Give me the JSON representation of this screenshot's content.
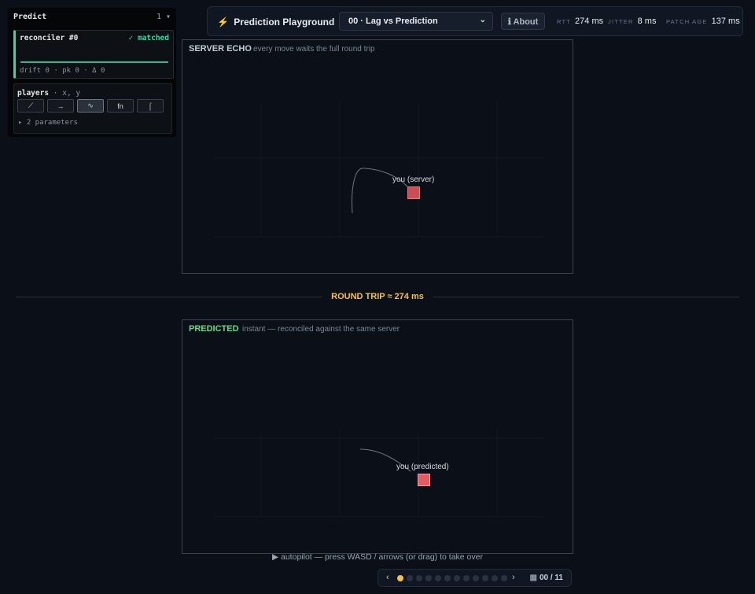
{
  "panel": {
    "title": "Predict",
    "count": "1 ▾",
    "reconciler": {
      "name": "reconciler #0",
      "status": "✓ matched",
      "drift": "drift 0 · pk 0 · Δ 0"
    },
    "players": {
      "label": "players",
      "fields": "· x, y",
      "tools": [
        {
          "name": "tool-linear",
          "glyph": "⟋"
        },
        {
          "name": "tool-step",
          "glyph": "→"
        },
        {
          "name": "tool-wave",
          "glyph": "∿"
        },
        {
          "name": "tool-function",
          "glyph": "fn"
        },
        {
          "name": "tool-curve",
          "glyph": "⌠"
        }
      ],
      "active_tool": "tool-wave",
      "params": "▸ 2 parameters"
    }
  },
  "topbar": {
    "bolt": "⚡",
    "title": "Prediction Playground",
    "scenario": "00 · Lag vs Prediction",
    "scenario_chevron": "⌄",
    "about": "ℹ About",
    "rtt_label": "RTT",
    "rtt_value": "274 ms",
    "jitter_label": "JITTER",
    "jitter_value": "8 ms",
    "patch_label": "PATCH AGE",
    "patch_value": "137 ms"
  },
  "server": {
    "label": "SERVER ECHO",
    "subtitle": "every move waits the full round trip",
    "avatar_label": "you (server)"
  },
  "divider": {
    "label": "ROUND TRIP ≈ 274 ms"
  },
  "predicted": {
    "label": "PREDICTED",
    "subtitle": "instant — reconciled against the same server",
    "avatar_label": "you (predicted)"
  },
  "autopilot": "▶ autopilot — press WASD / arrows (or drag) to take over",
  "pager": {
    "prev": "‹",
    "next": "›",
    "count": "00 / 11",
    "grid_icon": "▦",
    "total_steps": 12,
    "current_step": 0
  },
  "colors": {
    "accent": "#f2c14e",
    "matched": "#3fd3a0",
    "predicted": "#68d98a",
    "avatar": "#e45c63"
  }
}
